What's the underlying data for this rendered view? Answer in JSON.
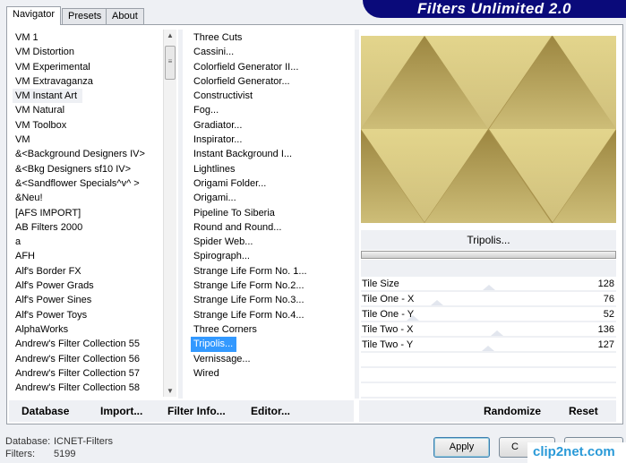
{
  "header": {
    "logo": "Filters Unlimited 2.0"
  },
  "tabs": [
    {
      "label": "Navigator",
      "active": true
    },
    {
      "label": "Presets"
    },
    {
      "label": "About"
    }
  ],
  "categories": {
    "items": [
      "VM 1",
      "VM Distortion",
      "VM Experimental",
      "VM Extravaganza",
      "VM Instant Art",
      "VM Natural",
      "VM Toolbox",
      "VM",
      "&<Background Designers IV>",
      "&<Bkg Designers sf10 IV>",
      "&<Sandflower Specials^v^ >",
      "&Neu!",
      "[AFS IMPORT]",
      "AB Filters 2000",
      "a",
      "AFH",
      "Alf's Border FX",
      "Alf's Power Grads",
      "Alf's Power Sines",
      "Alf's Power Toys",
      "AlphaWorks",
      "Andrew's Filter Collection 55",
      "Andrew's Filter Collection 56",
      "Andrew's Filter Collection 57",
      "Andrew's Filter Collection 58"
    ],
    "selected": "VM Instant Art"
  },
  "filters": {
    "items": [
      " Three Cuts",
      "Cassini...",
      "Colorfield Generator II...",
      "Colorfield Generator...",
      "Constructivist",
      "Fog...",
      "Gradiator...",
      "Inspirator...",
      "Instant Background I...",
      "Lightlines",
      "Origami Folder...",
      "Origami...",
      "Pipeline To Siberia",
      "Round and Round...",
      "Spider Web...",
      "Spirograph...",
      "Strange Life Form No. 1...",
      "Strange Life Form No.2...",
      "Strange Life Form No.3...",
      "Strange Life Form No.4...",
      "Three Corners",
      "Tripolis...",
      "Vernissage...",
      "Wired"
    ],
    "selected": "Tripolis..."
  },
  "preview": {
    "filter_name": "Tripolis...",
    "colors": {
      "dark": "#9c8640",
      "light": "#fff5b0"
    }
  },
  "params": [
    {
      "label": "Tile Size",
      "value": 128
    },
    {
      "label": "Tile One - X",
      "value": 76
    },
    {
      "label": "Tile One - Y",
      "value": 52
    },
    {
      "label": "Tile Two - X",
      "value": 136
    },
    {
      "label": "Tile Two - Y",
      "value": 127
    }
  ],
  "left_buttons": {
    "database": "Database",
    "import": "Import...",
    "filter_info": "Filter Info...",
    "editor": "Editor..."
  },
  "right_buttons": {
    "randomize": "Randomize",
    "reset": "Reset"
  },
  "status": {
    "database_label": "Database:",
    "database_value": "ICNET-Filters",
    "filters_label": "Filters:",
    "filters_value": "5199"
  },
  "dialog": {
    "apply": "Apply",
    "cancel": "C"
  },
  "watermark": "clip2net.com"
}
